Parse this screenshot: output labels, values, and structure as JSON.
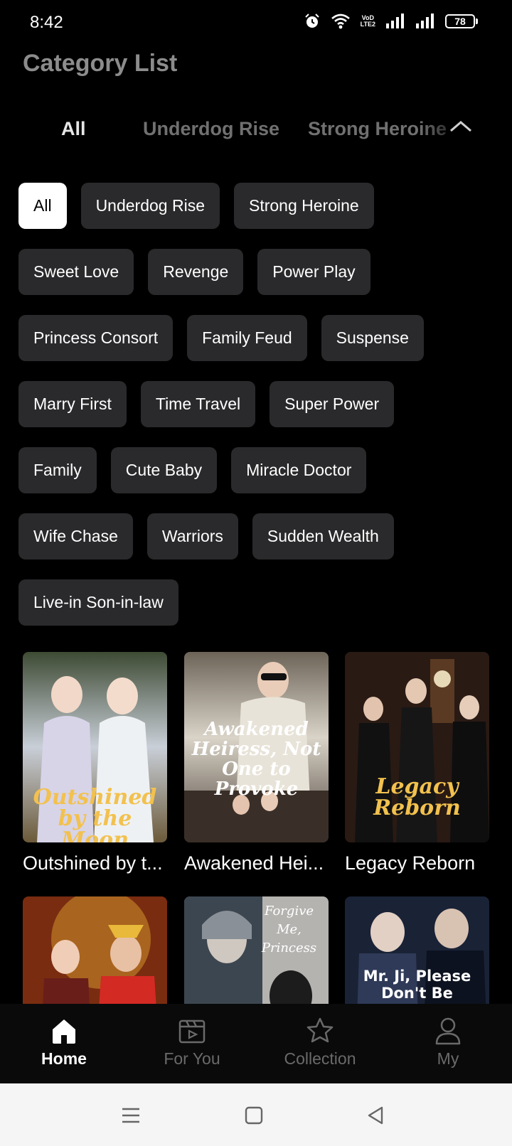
{
  "status_bar": {
    "time": "8:42",
    "volte_top": "VoD",
    "volte_bottom": "LTE2",
    "battery": "78"
  },
  "page_title": "Category List",
  "tabs": [
    "All",
    "Underdog Rise",
    "Strong Heroine"
  ],
  "chips": [
    [
      "All",
      "Underdog Rise",
      "Strong Heroine"
    ],
    [
      "Sweet Love",
      "Revenge",
      "Power Play"
    ],
    [
      "Princess Consort",
      "Family Feud",
      "Suspense"
    ],
    [
      "Marry First",
      "Time Travel",
      "Super Power"
    ],
    [
      "Family",
      "Cute Baby",
      "Miracle Doctor"
    ],
    [
      "Wife Chase",
      "Warriors",
      "Sudden Wealth"
    ],
    [
      "Live-in Son-in-law"
    ]
  ],
  "dramas": [
    {
      "title": "Outshined by t...",
      "cover_text": "Outshined by the Moon"
    },
    {
      "title": "Awakened Hei...",
      "cover_text": "Awakened Heiress, Not One to Provoke"
    },
    {
      "title": "Legacy Reborn",
      "cover_text": "Legacy Reborn"
    },
    {
      "title": "",
      "cover_text": ""
    },
    {
      "title": "",
      "cover_text": "Forgive Me, Princess"
    },
    {
      "title": "",
      "cover_text": "Mr. Ji, Please Don't Be"
    }
  ],
  "bottom_nav": [
    {
      "label": "Home",
      "icon": "home-icon",
      "active": true
    },
    {
      "label": "For You",
      "icon": "play-icon",
      "active": false
    },
    {
      "label": "Collection",
      "icon": "star-icon",
      "active": false
    },
    {
      "label": "My",
      "icon": "user-icon",
      "active": false
    }
  ],
  "colors": {
    "chip_bg": "#2a2a2c",
    "chip_selected_bg": "#ffffff",
    "accent_gold": "#f2c14e"
  }
}
